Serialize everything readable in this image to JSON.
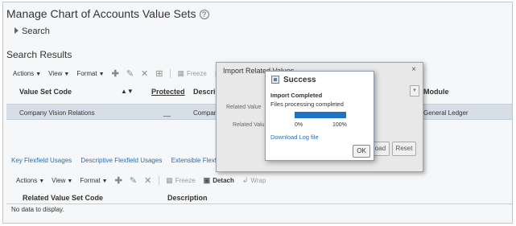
{
  "page": {
    "title": "Manage Chart of Accounts Value Sets",
    "search_label": "Search",
    "results_title": "Search Results"
  },
  "toolbar": {
    "actions": "Actions",
    "view": "View",
    "format": "Format",
    "freeze": "Freeze",
    "detach": "Detach",
    "wrap": "Wrap"
  },
  "table": {
    "columns": {
      "value_set_code": "Value Set Code",
      "protected": "Protected",
      "description": "Descript",
      "module": "Module"
    },
    "rows": [
      {
        "value_set_code": "Company Vision Relations",
        "protected": "__",
        "description": "Compan",
        "module": "General Ledger"
      }
    ]
  },
  "tabs": [
    "Key Flexfield Usages",
    "Descriptive Flexfield Usages",
    "Extensible Flexfield Usag"
  ],
  "detail": {
    "columns": {
      "related_value_set_code": "Related Value Set Code",
      "description": "Description"
    },
    "empty_text": "No data to display."
  },
  "import_dialog": {
    "title": "Import Related Values",
    "close": "×",
    "label_1": "Related Value",
    "label_2": "Related Value",
    "upload_partial": "oad",
    "reset": "Reset"
  },
  "success_dialog": {
    "title": "Success",
    "status": "Import Completed",
    "message": "Files processing completed",
    "progress": 1.0,
    "progress_min_label": "0%",
    "progress_max_label": "100%",
    "log_link": "Download Log file",
    "ok": "OK"
  },
  "colors": {
    "accent": "#1c73c8",
    "link": "#2a6cb1",
    "selected_row": "#d6dfe8"
  }
}
